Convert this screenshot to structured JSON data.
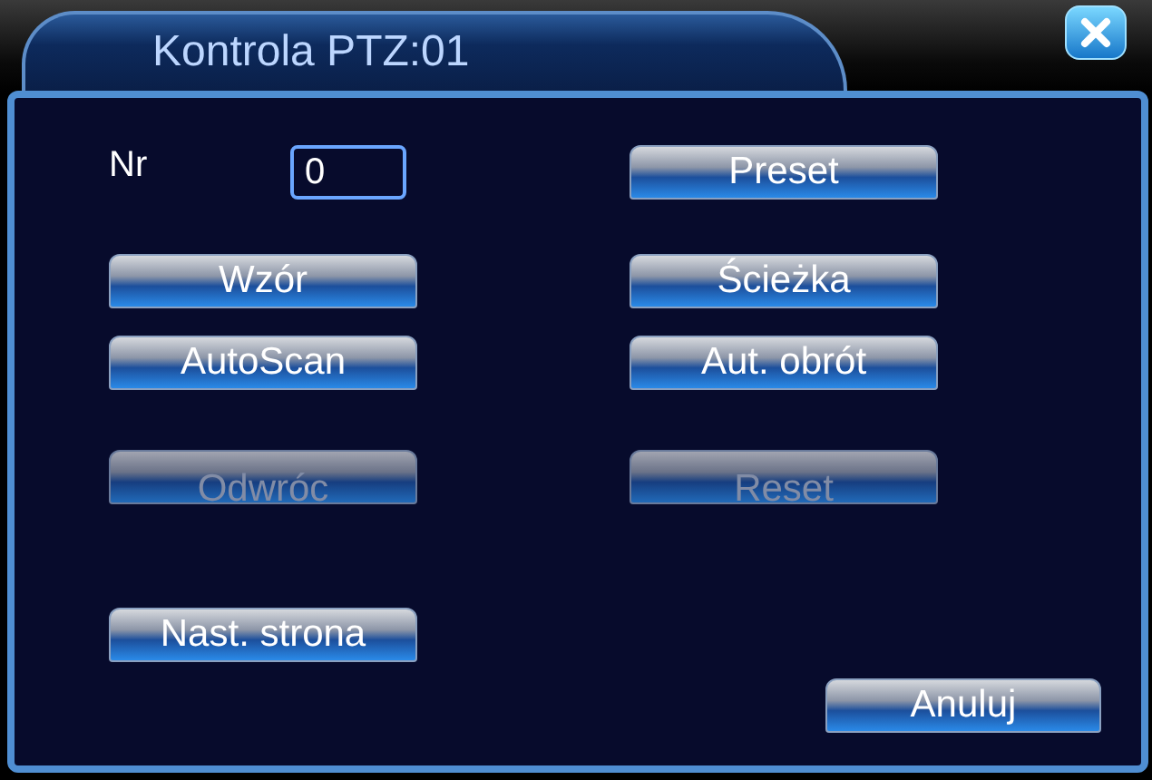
{
  "window": {
    "title": "Kontrola PTZ:01"
  },
  "number": {
    "label": "Nr",
    "value": "0"
  },
  "buttons": [
    {
      "label": "Preset",
      "disabled": false
    },
    {
      "label": "Wzór",
      "disabled": false
    },
    {
      "label": "Ścieżka",
      "disabled": false
    },
    {
      "label": "AutoScan",
      "disabled": false
    },
    {
      "label": "Aut. obrót",
      "disabled": false
    },
    {
      "label": "Odwróc",
      "disabled": true
    },
    {
      "label": "Reset",
      "disabled": true
    },
    {
      "label": "Nast. strona",
      "disabled": false
    }
  ],
  "cancel": {
    "label": "Anuluj"
  }
}
